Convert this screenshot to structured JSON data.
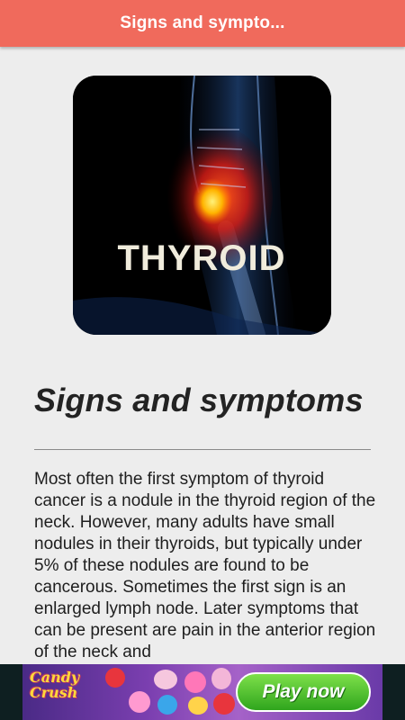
{
  "appbar": {
    "title": "Signs and sympto..."
  },
  "hero": {
    "image_text": "THYROID"
  },
  "article": {
    "heading": "Signs and symptoms",
    "body": "Most often the first symptom of thyroid cancer is a nodule in the thyroid region of the neck. However, many adults have small nodules in their thyroids, but typically under 5% of these nodules are found to be cancerous. Sometimes the first sign is an enlarged lymph node. Later symptoms that can be present are pain in the anterior region of the neck and"
  },
  "ad": {
    "logo_line1": "Candy",
    "logo_line2": "Crush",
    "cta_label": "Play now"
  },
  "colors": {
    "appbar": "#f06a5c",
    "background": "#ededed",
    "cta": "#2fa51d"
  }
}
